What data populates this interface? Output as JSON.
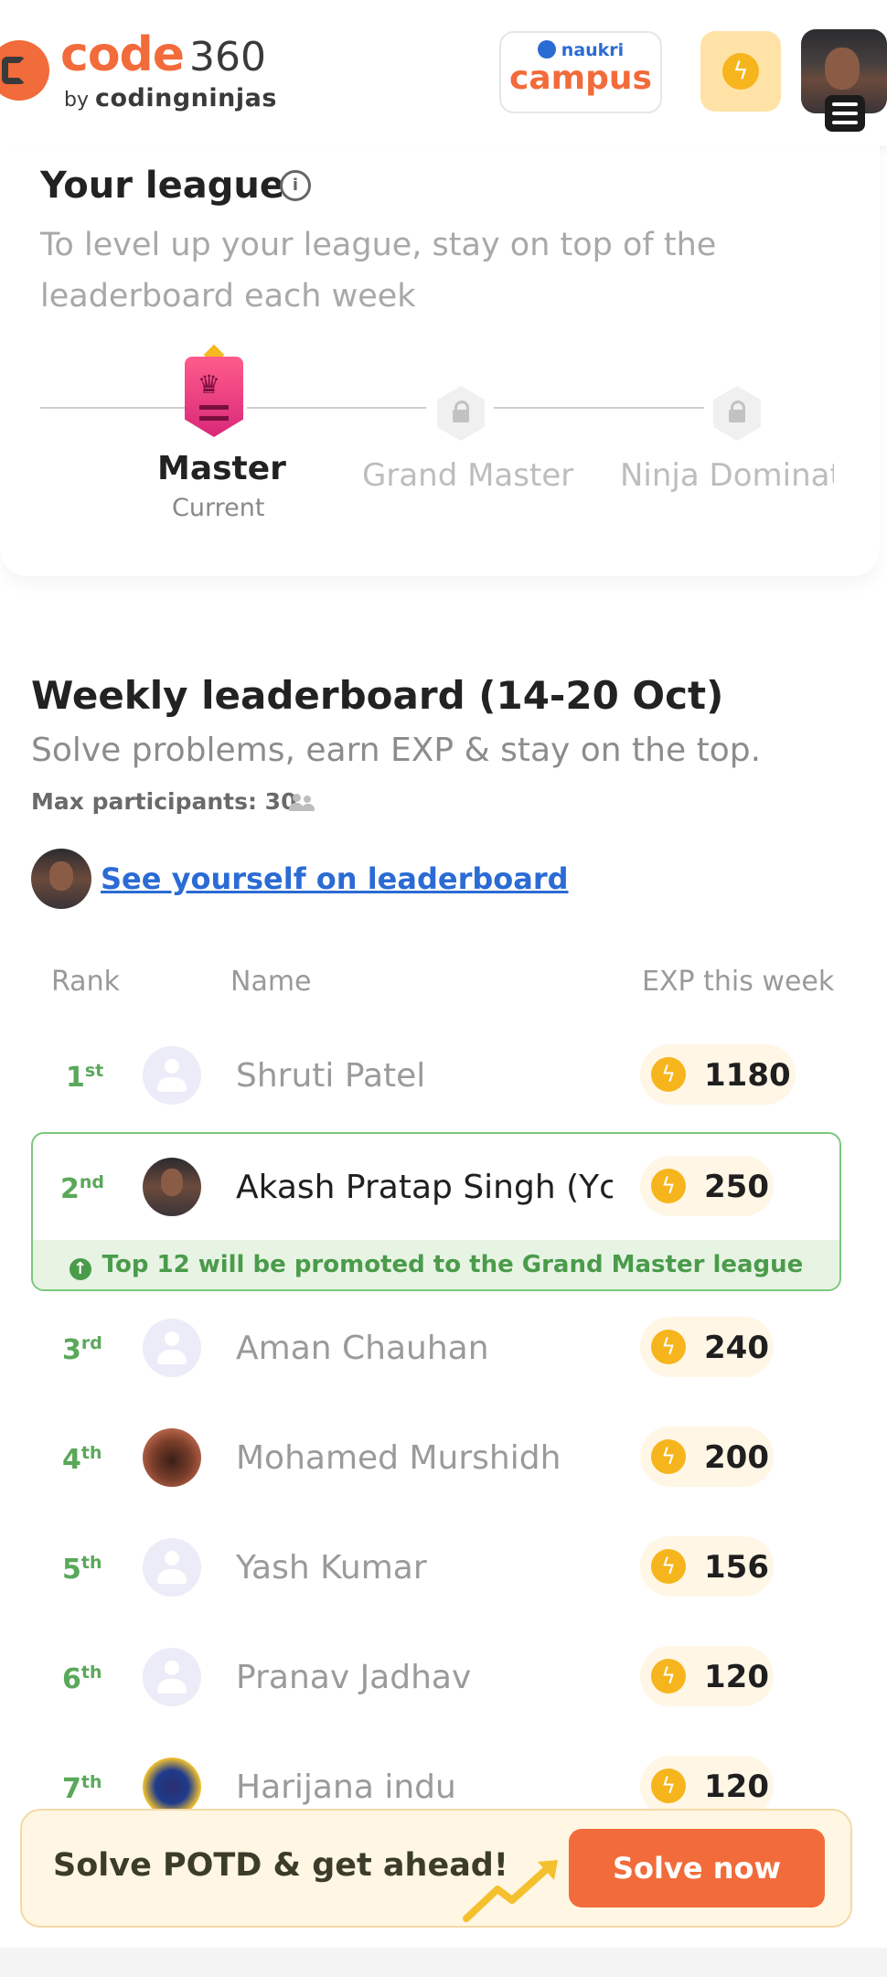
{
  "header": {
    "logo_code": "code",
    "logo_360": "360",
    "logo_by": "by",
    "logo_brand": "codingninjas",
    "naukri_small": "naukri",
    "naukri_big": "campus"
  },
  "league": {
    "title": "Your league",
    "subtitle": "To level up your league, stay on top of the leaderboard each week",
    "levels": [
      {
        "name": "Master",
        "status": "Current"
      },
      {
        "name": "Grand Master"
      },
      {
        "name": "Ninja Dominator"
      }
    ]
  },
  "weekly": {
    "title": "Weekly leaderboard (14-20 Oct)",
    "subtitle": "Solve problems, earn EXP & stay on the top.",
    "max_participants": "Max participants: 30",
    "see_yourself": "See yourself on leaderboard",
    "columns": {
      "rank": "Rank",
      "name": "Name",
      "exp": "EXP this week"
    },
    "rows": [
      {
        "rank": "1",
        "suffix": "st",
        "name": "Shruti Patel",
        "exp": "1180"
      },
      {
        "rank": "2",
        "suffix": "nd",
        "name": "Akash Pratap Singh (Yc",
        "exp": "250"
      },
      {
        "rank": "3",
        "suffix": "rd",
        "name": "Aman Chauhan",
        "exp": "240"
      },
      {
        "rank": "4",
        "suffix": "th",
        "name": "Mohamed Murshidh",
        "exp": "200"
      },
      {
        "rank": "5",
        "suffix": "th",
        "name": "Yash Kumar",
        "exp": "156"
      },
      {
        "rank": "6",
        "suffix": "th",
        "name": "Pranav Jadhav",
        "exp": "120"
      },
      {
        "rank": "7",
        "suffix": "th",
        "name": "Harijana indu",
        "exp": "120"
      }
    ],
    "promo": "Top 12 will be promoted to the Grand Master league"
  },
  "cta": {
    "text": "Solve POTD & get ahead!",
    "button": "Solve now"
  },
  "colors": {
    "brand_orange": "#f26b3a",
    "link_blue": "#2b6bd4",
    "rank_green": "#5aa85a",
    "exp_yellow": "#f6b51c"
  }
}
